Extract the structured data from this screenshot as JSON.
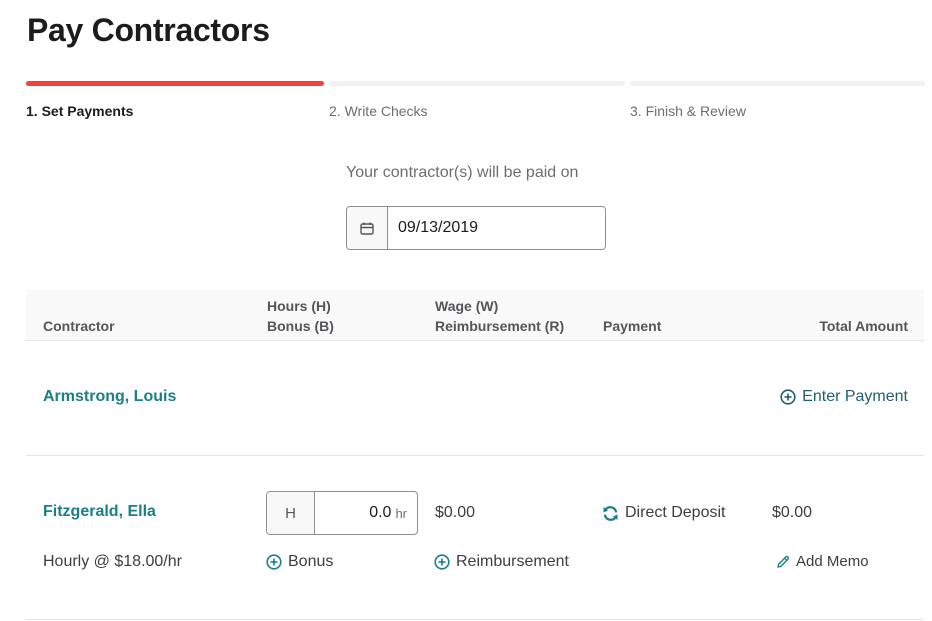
{
  "page": {
    "title": "Pay Contractors"
  },
  "stepper": {
    "steps": [
      {
        "label": "1. Set Payments",
        "active": true
      },
      {
        "label": "2. Write Checks",
        "active": false
      },
      {
        "label": "3. Finish & Review",
        "active": false
      }
    ]
  },
  "pay_date": {
    "label": "Your contractor(s) will be paid on",
    "value": "09/13/2019",
    "icon": "calendar-icon"
  },
  "table": {
    "headers": {
      "contractor": "Contractor",
      "hours_line1": "Hours (H)",
      "hours_line2": "Bonus (B)",
      "wage_line1": "Wage (W)",
      "wage_line2": "Reimbursement (R)",
      "payment": "Payment",
      "total": "Total Amount"
    },
    "rows": [
      {
        "name": "Armstrong, Louis",
        "action_label": "Enter Payment",
        "action_icon": "plus-circle-icon"
      },
      {
        "name": "Fitzgerald, Ella",
        "rate": "Hourly @ $18.00/hr",
        "hours_prefix": "H",
        "hours_value": "0.0",
        "hours_unit": "hr",
        "wage": "$0.00",
        "payment_method": "Direct Deposit",
        "payment_icon": "refresh-icon",
        "total": "$0.00",
        "bonus_label": "Bonus",
        "reimbursement_label": "Reimbursement",
        "memo_label": "Add Memo",
        "memo_icon": "pencil-icon"
      }
    ]
  },
  "colors": {
    "accent": "#f2403b",
    "link": "#1a7f86",
    "text": "#3d3d42",
    "muted": "#6d6d72"
  }
}
